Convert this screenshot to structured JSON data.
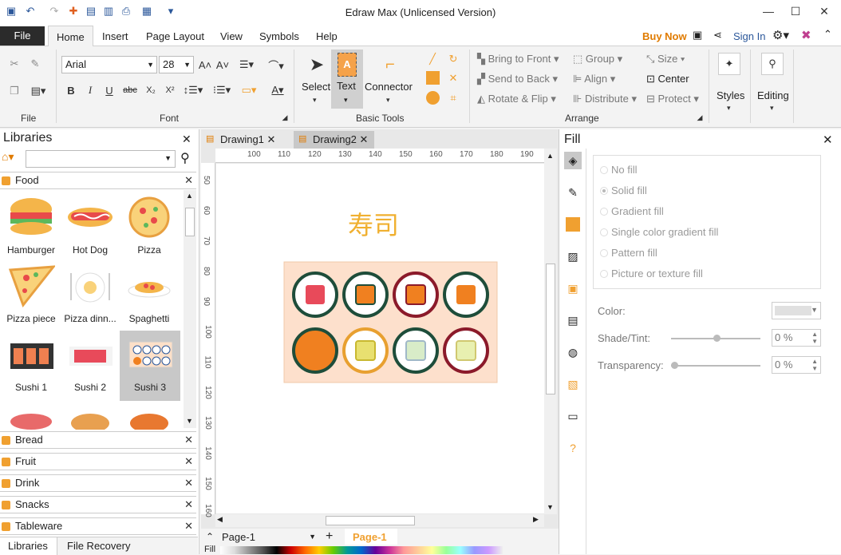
{
  "window": {
    "title": "Edraw Max (Unlicensed Version)"
  },
  "menu": {
    "file": "File",
    "tabs": [
      "Home",
      "Insert",
      "Page Layout",
      "View",
      "Symbols",
      "Help"
    ],
    "buy_now": "Buy Now",
    "sign_in": "Sign In"
  },
  "ribbon": {
    "groups": {
      "file": "File",
      "font": "Font",
      "basic_tools": "Basic Tools",
      "arrange": "Arrange"
    },
    "font_name": "Arial",
    "font_size": "28",
    "tools": {
      "select": "Select",
      "text": "Text",
      "connector": "Connector"
    },
    "arrange": {
      "bring_to_front": "Bring to Front",
      "send_to_back": "Send to Back",
      "rotate_flip": "Rotate & Flip",
      "group": "Group",
      "align": "Align",
      "distribute": "Distribute",
      "size": "Size",
      "center": "Center",
      "protect": "Protect"
    },
    "styles": "Styles",
    "editing": "Editing"
  },
  "libraries": {
    "title": "Libraries",
    "food_title": "Food",
    "shapes": [
      "Hamburger",
      "Hot Dog",
      "Pizza",
      "Pizza piece",
      "Pizza dinn...",
      "Spaghetti",
      "Sushi 1",
      "Sushi 2",
      "Sushi 3"
    ],
    "categories": [
      "Bread",
      "Fruit",
      "Drink",
      "Snacks",
      "Tableware"
    ],
    "bottom_tabs": [
      "Libraries",
      "File Recovery"
    ]
  },
  "document": {
    "tabs": [
      "Drawing1",
      "Drawing2"
    ],
    "ruler_h": [
      "100",
      "110",
      "120",
      "130",
      "140",
      "150",
      "160",
      "170",
      "180",
      "190"
    ],
    "ruler_v": [
      "50",
      "60",
      "70",
      "80",
      "90",
      "100",
      "110",
      "120",
      "130",
      "140",
      "150",
      "160"
    ],
    "heading": "寿司",
    "page_tab": "Page-1",
    "page_tab_active": "Page-1",
    "fill_label": "Fill"
  },
  "fill_panel": {
    "title": "Fill",
    "options": [
      "No fill",
      "Solid fill",
      "Gradient fill",
      "Single color gradient fill",
      "Pattern fill",
      "Picture or texture fill"
    ],
    "color_label": "Color:",
    "shade_label": "Shade/Tint:",
    "shade_value": "0 %",
    "transparency_label": "Transparency:",
    "transparency_value": "0 %"
  },
  "colors": {
    "accent": "#2b579a",
    "orange": "#f0a030",
    "selection": "#c8c8c8"
  }
}
